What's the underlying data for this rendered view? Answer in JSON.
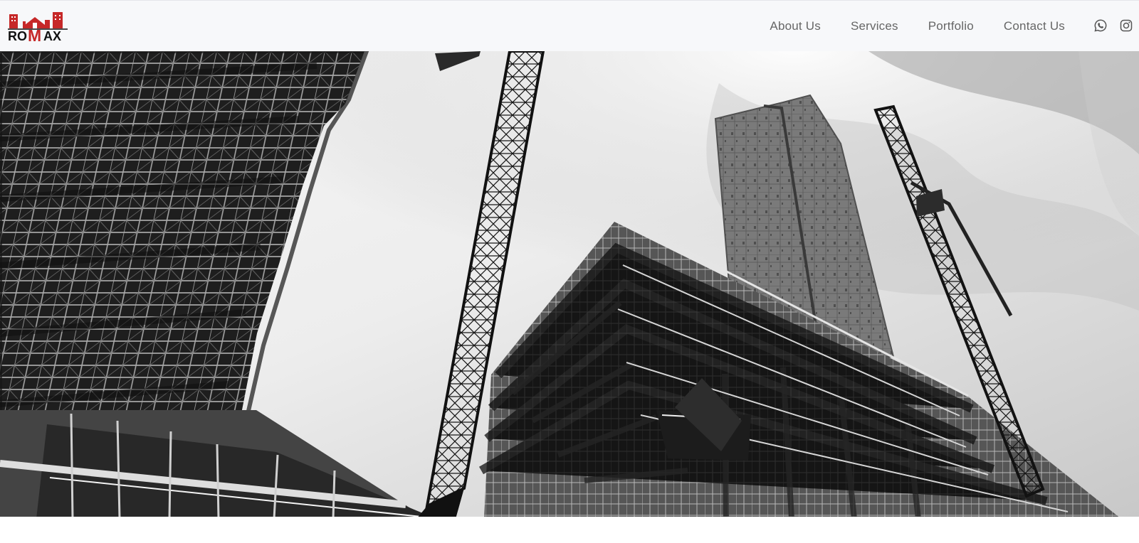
{
  "brand": {
    "name": "ROMAX",
    "logo_text_prefix": "RO",
    "logo_text_highlight": "M",
    "logo_text_suffix": "AX",
    "accent_color": "#d32f2f",
    "dark_color": "#111111"
  },
  "nav": {
    "links": [
      {
        "label": "About Us"
      },
      {
        "label": "Services"
      },
      {
        "label": "Portfolio"
      },
      {
        "label": "Contact Us"
      }
    ]
  },
  "social": {
    "icons": [
      {
        "name": "whatsapp-icon"
      },
      {
        "name": "instagram-icon"
      }
    ]
  },
  "hero": {
    "image_description": "construction-site-image",
    "slides": 3,
    "active_slide": 1
  }
}
